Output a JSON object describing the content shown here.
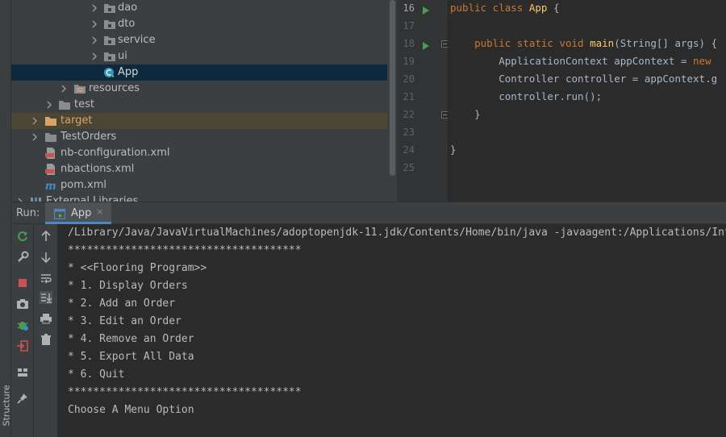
{
  "tree": {
    "items": [
      {
        "label": "dao"
      },
      {
        "label": "dto"
      },
      {
        "label": "service"
      },
      {
        "label": "ui"
      },
      {
        "label": "App"
      },
      {
        "label": "resources"
      },
      {
        "label": "test"
      },
      {
        "label": "target"
      },
      {
        "label": "TestOrders"
      },
      {
        "label": "nb-configuration.xml"
      },
      {
        "label": "nbactions.xml"
      },
      {
        "label": "pom.xml"
      },
      {
        "label": "External Libraries"
      }
    ]
  },
  "editor": {
    "line_numbers": [
      "16",
      "17",
      "18",
      "19",
      "20",
      "21",
      "22",
      "23",
      "24",
      "25"
    ],
    "lines": [
      [
        "public class ",
        "App",
        " {"
      ],
      [
        ""
      ],
      [
        "    public static void ",
        "main",
        "(String[] args) {"
      ],
      [
        "        ApplicationContext appContext = ",
        "new"
      ],
      [
        "        Controller controller = appContext.g"
      ],
      [
        "        controller.run();"
      ],
      [
        "    }"
      ],
      [
        ""
      ],
      [
        "}"
      ],
      [
        ""
      ]
    ]
  },
  "run_panel": {
    "label": "Run:",
    "tab_label": "App",
    "tab_close": "×"
  },
  "structure_tab": "Structure",
  "console": {
    "lines": [
      "/Library/Java/JavaVirtualMachines/adoptopenjdk-11.jdk/Contents/Home/bin/java -javaagent:/Applications/Int",
      "*************************************",
      "* <<Flooring Program>>",
      "* 1. Display Orders",
      "* 2. Add an Order",
      "* 3. Edit an Order",
      "* 4. Remove an Order",
      "* 5. Export All Data",
      "* 6. Quit",
      "*************************************",
      "Choose A Menu Option"
    ]
  },
  "colors": {
    "accent": "#4a88c7",
    "run_green": "#499c54",
    "stop_red": "#c75450",
    "folder": "#8c8c8c",
    "excluded_folder": "#d6a36c"
  }
}
